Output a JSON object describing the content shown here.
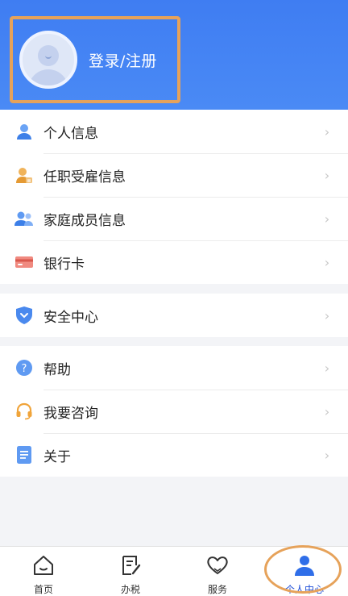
{
  "header": {
    "login_text": "登录/注册"
  },
  "menu_groups": [
    {
      "items": [
        {
          "label": "个人信息",
          "icon": "person-icon"
        },
        {
          "label": "任职受雇信息",
          "icon": "employment-icon"
        },
        {
          "label": "家庭成员信息",
          "icon": "family-icon"
        },
        {
          "label": "银行卡",
          "icon": "bank-card-icon"
        }
      ]
    },
    {
      "items": [
        {
          "label": "安全中心",
          "icon": "shield-icon"
        }
      ]
    },
    {
      "items": [
        {
          "label": "帮助",
          "icon": "help-icon"
        },
        {
          "label": "我要咨询",
          "icon": "headset-icon"
        },
        {
          "label": "关于",
          "icon": "document-icon"
        }
      ]
    }
  ],
  "tabs": [
    {
      "label": "首页",
      "icon": "home-icon"
    },
    {
      "label": "办税",
      "icon": "tax-icon"
    },
    {
      "label": "服务",
      "icon": "heart-icon"
    },
    {
      "label": "个人中心",
      "icon": "user-center-icon",
      "active": true
    }
  ],
  "colors": {
    "header_blue": "#3f7df2",
    "highlight": "#e6a25a",
    "active_tab": "#1f4fd8"
  }
}
